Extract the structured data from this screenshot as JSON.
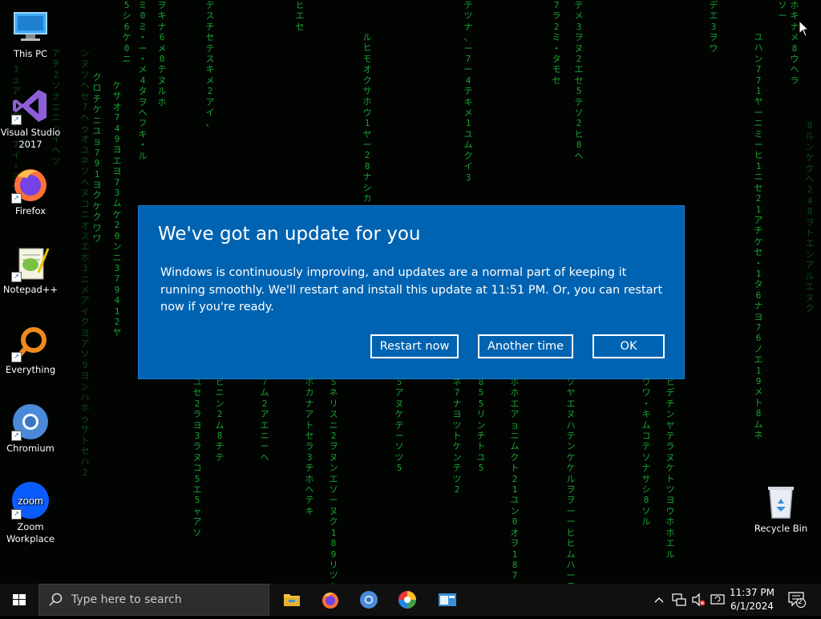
{
  "desktop": {
    "matrix_columns": [
      {
        "text": "5シ6ケ0ニ",
        "dim": false
      },
      {
        "text": "ヲキナ6メ0テヌルホ",
        "dim": false
      },
      {
        "text": "ミ0ミ・ー・メ4タヲヘフキ・ル",
        "dim": false
      },
      {
        "text": "テスチセテスキメ2アイ、",
        "dim": false
      },
      {
        "text": "ヒエセ",
        "dim": false
      },
      {
        "text": "テツナ、ー7ー4テキメ1ユムクイ3",
        "dim": false
      },
      {
        "text": "7ラ2ミ・タモセ",
        "dim": false
      },
      {
        "text": "テメ3ヲヌ2エセ5テソ2ヒ8ヘ",
        "dim": false
      },
      {
        "text": "デエ3ヲワ",
        "dim": false
      },
      {
        "text": "ソー",
        "dim": false
      },
      {
        "text": "ホキナメ8ウヘラ",
        "dim": false
      }
    ],
    "icons": [
      {
        "label": "This PC",
        "shortcut": false
      },
      {
        "label": "Visual Studio 2017",
        "shortcut": true
      },
      {
        "label": "Firefox",
        "shortcut": true
      },
      {
        "label": "Notepad++",
        "shortcut": true
      },
      {
        "label": "Everything",
        "shortcut": true
      },
      {
        "label": "Chromium",
        "shortcut": true
      },
      {
        "label": "Zoom Workplace",
        "shortcut": true,
        "icon_text": "zoom"
      },
      {
        "label": "Recycle Bin",
        "shortcut": false
      }
    ]
  },
  "dialog": {
    "title": "We've got an update for you",
    "body": "Windows is continuously improving, and updates are a normal part of keeping it running smoothly. We'll restart and install this update at 11:51 PM. Or, you can restart now if you're ready.",
    "buttons": {
      "restart_now": "Restart now",
      "another_time": "Another time",
      "ok": "OK"
    },
    "bg_color": "#0063b1"
  },
  "taskbar": {
    "search_placeholder": "Type here to search",
    "pinned_apps": [
      "file-explorer-icon",
      "firefox-icon",
      "chromium-icon",
      "color-app-icon",
      "window-app-icon"
    ],
    "tray": {
      "clock_time": "11:37 PM",
      "clock_date": "6/1/2024",
      "notification_count": "2"
    }
  },
  "colors": {
    "matrix_green": "#1fbf3a",
    "taskbar": "#101010",
    "search_box": "#2d2d2d"
  }
}
